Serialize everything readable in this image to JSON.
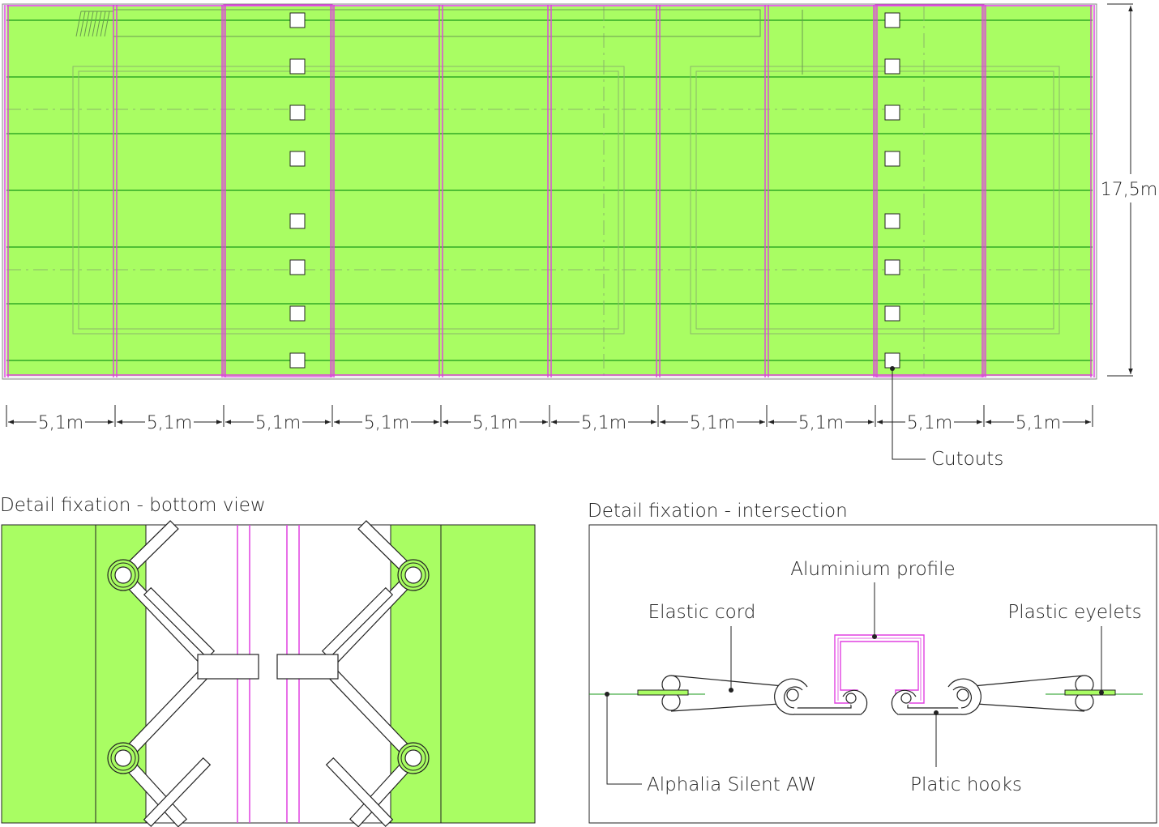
{
  "plan": {
    "height_dimension": "17,5m",
    "width_dimensions": [
      "5,1m",
      "5,1m",
      "5,1m",
      "5,1m",
      "5,1m",
      "5,1m",
      "5,1m",
      "5,1m",
      "5,1m",
      "5,1m"
    ],
    "cutouts_label": "Cutouts"
  },
  "bottom_view": {
    "title": "Detail fixation - bottom view"
  },
  "intersection": {
    "title": "Detail fixation - intersection",
    "labels": {
      "aluminium_profile": "Aluminium profile",
      "elastic_cord": "Elastic cord",
      "plastic_eyelets": "Plastic eyelets",
      "alphalia": "Alphalia Silent AW",
      "plastic_hooks": "Platic hooks"
    }
  },
  "colors": {
    "panel_green": "#a9fd63",
    "line_green": "#1a9a1a",
    "profile_magenta": "#e040e0",
    "outline": "#222222"
  }
}
